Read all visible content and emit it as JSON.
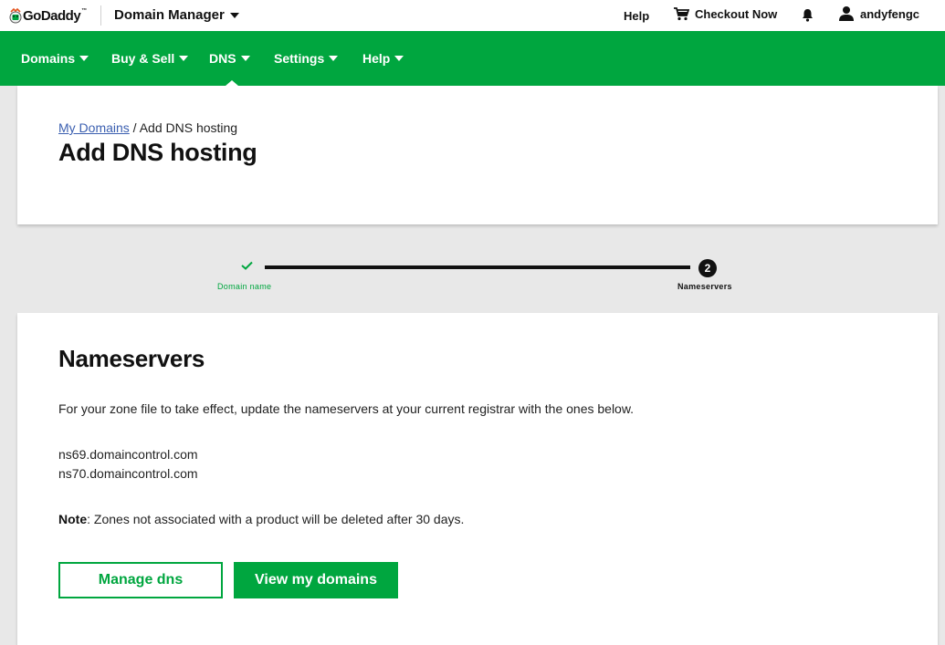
{
  "brand": {
    "logo_text": "GoDaddy",
    "trademark": "™",
    "primary_color": "#00a63f"
  },
  "topbar": {
    "product_label": "Domain Manager",
    "help_label": "Help",
    "checkout_label": "Checkout Now",
    "username": "andyfengc"
  },
  "nav": {
    "items": [
      {
        "label": "Domains"
      },
      {
        "label": "Buy & Sell"
      },
      {
        "label": "DNS"
      },
      {
        "label": "Settings"
      },
      {
        "label": "Help"
      }
    ],
    "active": "DNS"
  },
  "header": {
    "breadcrumb_link": "My Domains",
    "breadcrumb_separator": " / ",
    "breadcrumb_current": "Add DNS hosting",
    "title": "Add DNS hosting"
  },
  "stepper": {
    "step1_label": "Domain name",
    "step2_number": "2",
    "step2_label": "Nameservers"
  },
  "main": {
    "title": "Nameservers",
    "info": "For your zone file to take effect, update the nameservers at your current registrar with the ones below.",
    "nameservers": [
      "ns69.domaincontrol.com",
      "ns70.domaincontrol.com"
    ],
    "note_label": "Note",
    "note_text": ": Zones not associated with a product will be deleted after 30 days.",
    "manage_button": "Manage dns",
    "view_button": "View my domains"
  }
}
